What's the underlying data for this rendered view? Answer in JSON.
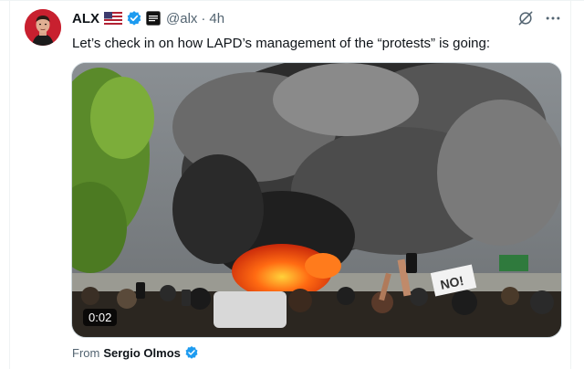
{
  "post": {
    "author_name": "ALX",
    "handle": "@alx",
    "separator": "·",
    "time_ago": "4h",
    "text": "Let’s check in on how LAPD’s management of the “protests” is going:",
    "video": {
      "duration": "0:02",
      "sign_text": "NO!"
    },
    "source": {
      "prefix": "From",
      "name": "Sergio Olmos"
    }
  },
  "icons": {
    "flag": "us-flag-icon",
    "verified": "verified-badge-icon",
    "affiliate": "affiliate-badge-icon",
    "grok": "grok-icon",
    "more": "more-options-icon"
  },
  "colors": {
    "verified_blue": "#1d9bf0",
    "secondary_text": "#536471",
    "primary_text": "#0f1419"
  }
}
